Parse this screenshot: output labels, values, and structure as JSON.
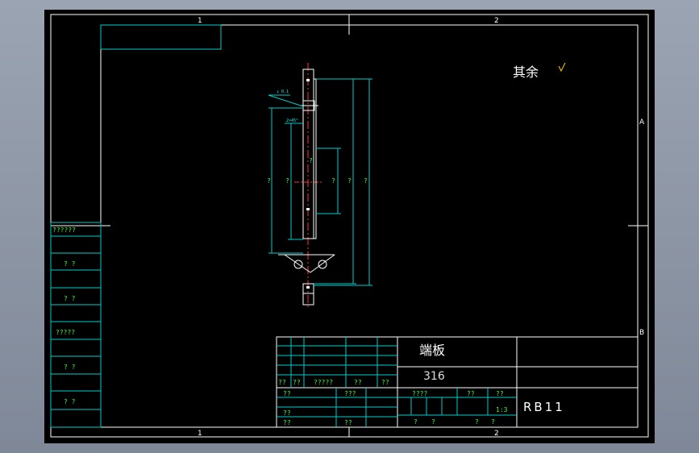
{
  "zones": {
    "top": [
      "1",
      "2"
    ],
    "bottom": [
      "1",
      "2"
    ],
    "right": [
      "A",
      "B"
    ]
  },
  "roughness_note": "其余",
  "part_view": {
    "chamfer_note": "2×45°",
    "dims": [
      "?",
      "?",
      "?",
      "?",
      "?",
      "?"
    ]
  },
  "side_stamp": [
    "??????",
    "? ?",
    "? ?",
    "?????",
    "? ?",
    "? ?"
  ],
  "title_block": {
    "part_name": "端板",
    "material": "316",
    "drawing_no": "RB11",
    "scale": "1:3",
    "row_labels": [
      "??",
      "??",
      "?????",
      "??",
      "??"
    ],
    "lower_left": [
      "??",
      "???",
      "??",
      "??",
      "??"
    ],
    "info_labels": [
      "????",
      "??",
      "??"
    ],
    "bottom_labels": [
      "?",
      "?",
      "?",
      "?"
    ]
  }
}
